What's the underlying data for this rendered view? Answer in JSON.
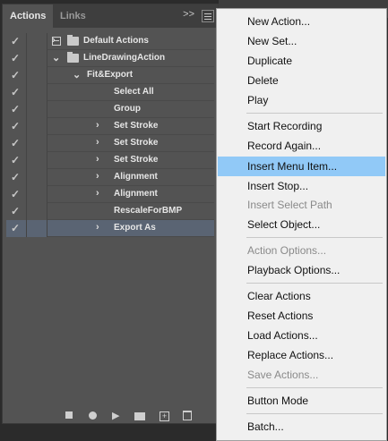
{
  "tabs": [
    {
      "label": "Actions",
      "active": true
    },
    {
      "label": "Links",
      "active": false
    }
  ],
  "panel_controls": {
    "collapse_glyph": ">>"
  },
  "actions_list": [
    {
      "label": "Default Actions",
      "type": "set",
      "expanded": false,
      "dialog": true,
      "indent": 0
    },
    {
      "label": "LineDrawingAction",
      "type": "set",
      "expanded": true,
      "dialog": false,
      "indent": 0
    },
    {
      "label": "Fit&Export",
      "type": "action",
      "expanded": true,
      "dialog": false,
      "indent": 1
    },
    {
      "label": "Select All",
      "type": "step",
      "expanded": null,
      "dialog": false,
      "indent": 2
    },
    {
      "label": "Group",
      "type": "step",
      "expanded": null,
      "dialog": false,
      "indent": 2
    },
    {
      "label": "Set Stroke",
      "type": "step",
      "expanded": false,
      "dialog": false,
      "indent": 2
    },
    {
      "label": "Set Stroke",
      "type": "step",
      "expanded": false,
      "dialog": false,
      "indent": 2
    },
    {
      "label": "Set Stroke",
      "type": "step",
      "expanded": false,
      "dialog": false,
      "indent": 2
    },
    {
      "label": "Alignment",
      "type": "step",
      "expanded": false,
      "dialog": false,
      "indent": 2
    },
    {
      "label": "Alignment",
      "type": "step",
      "expanded": false,
      "dialog": false,
      "indent": 2
    },
    {
      "label": "RescaleForBMP",
      "type": "step",
      "expanded": null,
      "dialog": false,
      "indent": 2
    },
    {
      "label": "Export As",
      "type": "step",
      "expanded": false,
      "dialog": false,
      "indent": 2,
      "selected": true
    }
  ],
  "context_menu": {
    "items": [
      {
        "label": "New Action...",
        "enabled": true
      },
      {
        "label": "New Set...",
        "enabled": true
      },
      {
        "label": "Duplicate",
        "enabled": true
      },
      {
        "label": "Delete",
        "enabled": true
      },
      {
        "label": "Play",
        "enabled": true
      },
      {
        "label": "Start Recording",
        "enabled": true
      },
      {
        "label": "Record Again...",
        "enabled": true
      },
      {
        "label": "Insert Menu Item...",
        "enabled": true,
        "highlighted": true
      },
      {
        "label": "Insert Stop...",
        "enabled": true
      },
      {
        "label": "Insert Select Path",
        "enabled": false
      },
      {
        "label": "Select Object...",
        "enabled": true
      },
      {
        "label": "Action Options...",
        "enabled": false
      },
      {
        "label": "Playback Options...",
        "enabled": true
      },
      {
        "label": "Clear Actions",
        "enabled": true
      },
      {
        "label": "Reset Actions",
        "enabled": true
      },
      {
        "label": "Load Actions...",
        "enabled": true
      },
      {
        "label": "Replace Actions...",
        "enabled": true
      },
      {
        "label": "Save Actions...",
        "enabled": false
      },
      {
        "label": "Button Mode",
        "enabled": true
      },
      {
        "label": "Batch...",
        "enabled": true
      }
    ]
  },
  "bottom_toolbar": [
    "stop-icon",
    "record-icon",
    "play-icon",
    "folder-icon",
    "new-action-icon",
    "trash-icon"
  ],
  "colors": {
    "panel_bg": "#535353",
    "selected_row": "#5a6473",
    "menu_bg": "#f0f0f0",
    "menu_highlight": "#91c9f7"
  }
}
